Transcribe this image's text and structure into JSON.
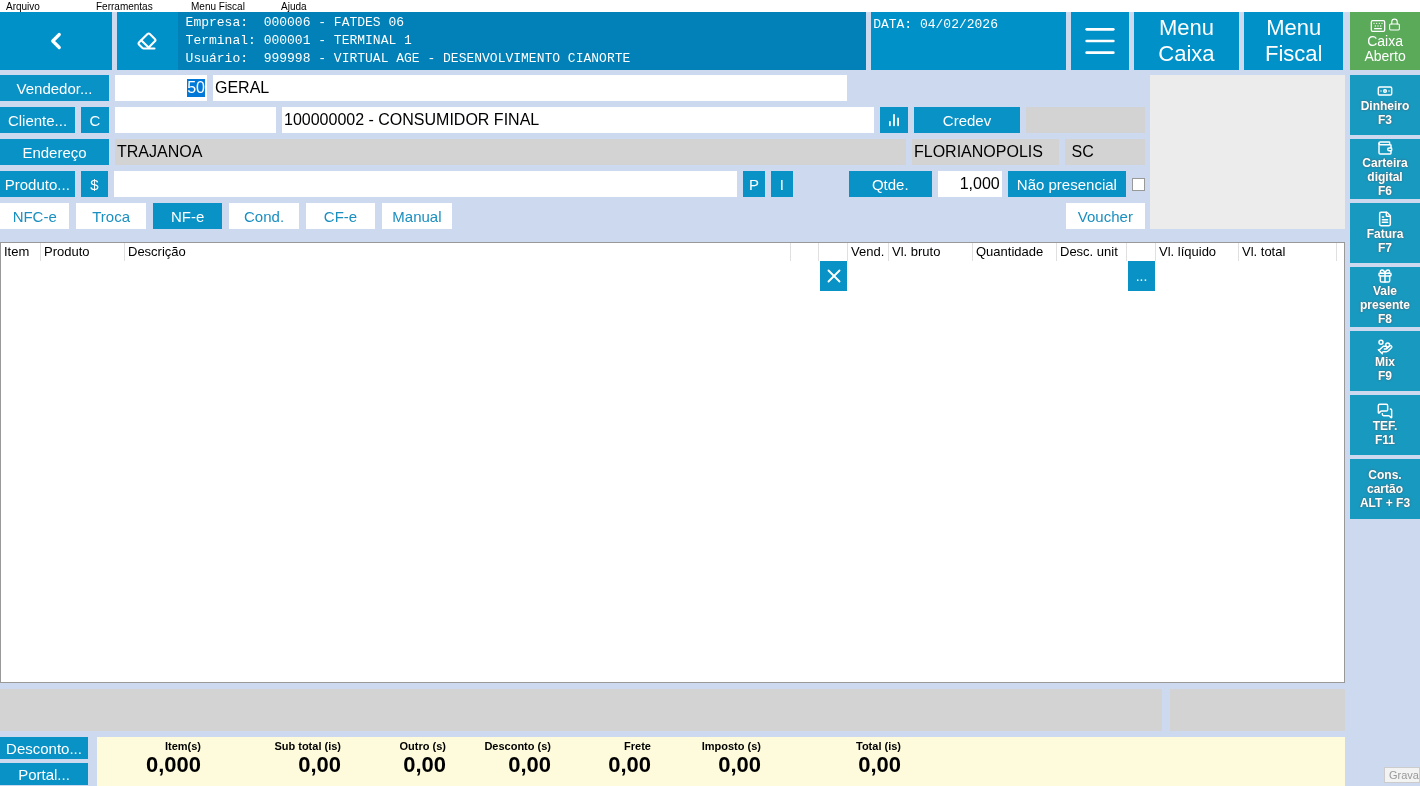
{
  "menu_bar": [
    "Arquivo",
    "Ferramentas",
    "Menu Fiscal",
    "Ajuda"
  ],
  "header": {
    "info": [
      {
        "label": "Empresa:",
        "value": "000006 - FATDES 06"
      },
      {
        "label": "Terminal:",
        "value": "000001 - TERMINAL 1"
      },
      {
        "label": "Usuário:",
        "value": "999998 - VIRTUAL AGE - DESENVOLVIMENTO CIANORTE"
      }
    ],
    "date": "DATA: 04/02/2026",
    "buttons": [
      "Menu Caixa",
      "Menu Fiscal"
    ],
    "status": "Caixa Aberto"
  },
  "form": {
    "vendedor": {
      "button": "Vendedor...",
      "code": "50",
      "name": "GERAL"
    },
    "cliente": {
      "button": "Cliente...",
      "type_button": "C",
      "name": "100000002 - CONSUMIDOR FINAL",
      "credev": "Credev"
    },
    "endereco": {
      "button": "Endereço",
      "street": "TRAJANOA",
      "city": "FLORIANOPOLIS",
      "state": "SC"
    },
    "produto": {
      "button": "Produto...",
      "price_button": "$",
      "p_button": "P",
      "i_button": "I",
      "qty_button": "Qtde.",
      "qty": "1,000",
      "nao_presencial": "Não presencial",
      "nao_presencial_checked": false
    },
    "tabs": [
      {
        "label": "NFC-e",
        "selected": false
      },
      {
        "label": "Troca",
        "selected": false
      },
      {
        "label": "NF-e",
        "selected": true
      },
      {
        "label": "Cond.",
        "selected": false
      },
      {
        "label": "CF-e",
        "selected": false
      },
      {
        "label": "Manual",
        "selected": false
      }
    ],
    "voucher": "Voucher"
  },
  "table": {
    "columns": [
      "Item",
      "Produto",
      "Descrição",
      "",
      "",
      "Vend.",
      "Vl. bruto",
      "Quantidade",
      "Desc. unit",
      "",
      "Vl. líquido",
      "Vl. total"
    ],
    "row_buttons": [
      "..."
    ]
  },
  "bottom": {
    "buttons": [
      "Desconto...",
      "Portal..."
    ],
    "totals": [
      {
        "label": "Item(s)",
        "value": "0,000"
      },
      {
        "label": "Sub total (is)",
        "value": "0,00"
      },
      {
        "label": "Outro (s)",
        "value": "0,00"
      },
      {
        "label": "Desconto (s)",
        "value": "0,00"
      },
      {
        "label": "Frete",
        "value": "0,00"
      },
      {
        "label": "Imposto (s)",
        "value": "0,00"
      },
      {
        "label": "Total (is)",
        "value": "0,00"
      }
    ]
  },
  "sidebar": [
    {
      "kind": "cash",
      "label": "Dinheiro",
      "shortcut": "F3"
    },
    {
      "kind": "wallet",
      "label": "Carteira digital",
      "shortcut": "F6"
    },
    {
      "kind": "invoice",
      "label": "Fatura",
      "shortcut": "F7"
    },
    {
      "kind": "gift",
      "label": "Vale presente",
      "shortcut": "F8"
    },
    {
      "kind": "mix",
      "label": "Mix",
      "shortcut": "F9"
    },
    {
      "kind": "tef",
      "label": "TEF.",
      "shortcut": "F11"
    },
    {
      "kind": "text",
      "label": "Cons. cartão",
      "shortcut": "ALT + F3"
    }
  ],
  "corner_button": "Grava"
}
